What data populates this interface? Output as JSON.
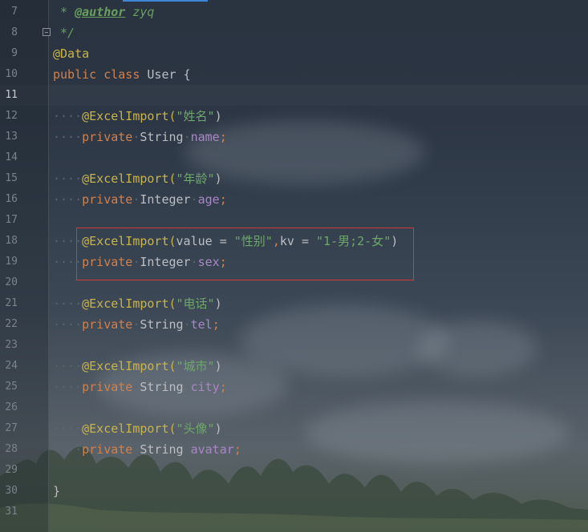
{
  "editor": {
    "line_numbers": [
      "7",
      "8",
      "9",
      "10",
      "11",
      "12",
      "13",
      "14",
      "15",
      "16",
      "17",
      "18",
      "19",
      "20",
      "21",
      "22",
      "23",
      "24",
      "25",
      "26",
      "27",
      "28",
      "29",
      "30",
      "31"
    ],
    "active_line": "11",
    "lines": {
      "l7": {
        "star": " * ",
        "tag": "@author",
        "author": " zyq"
      },
      "l8": {
        "close": " */"
      },
      "l9": {
        "annotation": "@Data"
      },
      "l10": {
        "kw_public": "public",
        "kw_class": "class",
        "classname": "User",
        "brace": "{"
      },
      "l12": {
        "indent": "····",
        "annotation": "@ExcelImport(",
        "value": "\"姓名\"",
        "close": ")"
      },
      "l13": {
        "indent": "····",
        "kw": "private",
        "type": "String",
        "field": "name",
        "semi": ";"
      },
      "l15": {
        "indent": "····",
        "annotation": "@ExcelImport(",
        "value": "\"年龄\"",
        "close": ")"
      },
      "l16": {
        "indent": "····",
        "kw": "private",
        "type": "Integer",
        "field": "age",
        "semi": ";"
      },
      "l18": {
        "indent": "····",
        "annotation": "@ExcelImport(",
        "p1": "value = ",
        "v1": "\"性别\"",
        "sep": ",",
        "p2": "kv = ",
        "v2": "\"1-男;2-女\"",
        "close": ")"
      },
      "l19": {
        "indent": "····",
        "kw": "private",
        "type": "Integer",
        "field": "sex",
        "semi": ";"
      },
      "l21": {
        "indent": "····",
        "annotation": "@ExcelImport(",
        "value": "\"电话\"",
        "close": ")"
      },
      "l22": {
        "indent": "····",
        "kw": "private",
        "type": "String",
        "field": "tel",
        "semi": ";"
      },
      "l24": {
        "indent": "····",
        "annotation": "@ExcelImport(",
        "value": "\"城市\"",
        "close": ")"
      },
      "l25": {
        "indent": "····",
        "kw": "private",
        "type": "String",
        "field": "city",
        "semi": ";"
      },
      "l27": {
        "indent": "····",
        "annotation": "@ExcelImport(",
        "value": "\"头像\"",
        "close": ")"
      },
      "l28": {
        "indent": "····",
        "kw": "private",
        "type": "String",
        "field": "avatar",
        "semi": ";"
      },
      "l30": {
        "brace": "}"
      }
    }
  },
  "colors": {
    "annotation": "#c9b44a",
    "keyword": "#d0814e",
    "field": "#a887c4",
    "string": "#6ea66b",
    "comment": "#699f5e",
    "highlight_box": "#d6393b"
  }
}
